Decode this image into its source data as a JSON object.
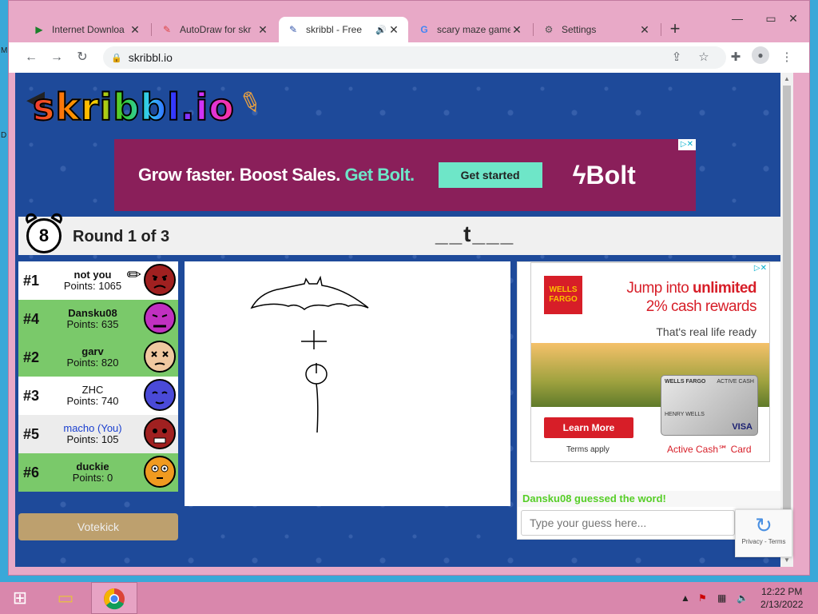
{
  "desktop": {
    "left_labels": [
      "M",
      "D"
    ]
  },
  "tabs": [
    {
      "title": "Internet Downloa",
      "icon": "play-icon",
      "close": "✕"
    },
    {
      "title": "AutoDraw for skr",
      "icon": "autodraw-icon",
      "close": "✕"
    },
    {
      "title": "skribbl - Free",
      "icon": "skribbl-icon",
      "close": "✕",
      "audio": "🔊"
    },
    {
      "title": "scary maze game",
      "icon": "google-icon",
      "close": "✕"
    },
    {
      "title": "Settings",
      "icon": "gear-icon",
      "close": "✕"
    }
  ],
  "new_tab": "+",
  "window_controls": {
    "minimize": "—",
    "maximize": "▭",
    "close": "✕"
  },
  "address_bar": {
    "url": "skribbl.io"
  },
  "page": {
    "logo": "skribbl.io",
    "top_ad": {
      "headline_a": "Grow faster. Boost Sales.",
      "headline_b": "Get Bolt.",
      "cta": "Get started",
      "brand": "Bolt",
      "adchoices": "▷✕"
    },
    "round": {
      "timer": "8",
      "label": "Round 1 of 3",
      "word_hint": "__t___"
    },
    "players": [
      {
        "rank": "#1",
        "name": "not you",
        "points": "Points: 1065",
        "drawing": true,
        "you": false
      },
      {
        "rank": "#4",
        "name": "Dansku08",
        "points": "Points: 635",
        "drawing": false,
        "you": false
      },
      {
        "rank": "#2",
        "name": "garv",
        "points": "Points: 820",
        "drawing": false,
        "you": false
      },
      {
        "rank": "#3",
        "name": "ZHC",
        "points": "Points: 740",
        "drawing": false,
        "you": false
      },
      {
        "rank": "#5",
        "name": "macho (You)",
        "points": "Points: 105",
        "drawing": false,
        "you": true
      },
      {
        "rank": "#6",
        "name": "duckie",
        "points": "Points: 0",
        "drawing": false,
        "you": false
      }
    ],
    "votekick": "Votekick",
    "side_ad": {
      "bank": "WELLS FARGO",
      "line1": "Jump into",
      "line1_bold": "unlimited",
      "line2": "2% cash rewards",
      "sub": "That's real life ready",
      "card_bank": "WELLS FARGO",
      "card_type": "ACTIVE CASH",
      "card_holder": "HENRY WELLS",
      "card_network": "VISA",
      "cta": "Learn More",
      "terms": "Terms apply",
      "card_name": "Active Cash℠ Card"
    },
    "chat": {
      "message": "Dansku08 guessed the word!",
      "placeholder": "Type your guess here..."
    },
    "recaptcha": {
      "links": "Privacy - Terms"
    }
  },
  "taskbar": {
    "time": "12:22 PM",
    "date": "2/13/2022"
  },
  "colors": {
    "page_bg": "#1e4a9a",
    "green_row": "#7ac96a",
    "chat_green": "#56ce27",
    "tab_strip": "#e8a9c7"
  }
}
